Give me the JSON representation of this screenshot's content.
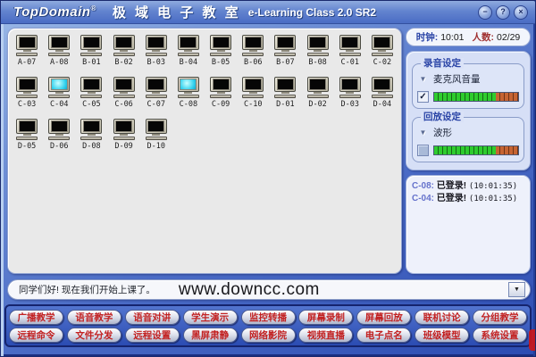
{
  "title_bar": {
    "brand": "TopDomain",
    "reg": "®",
    "title_cn": "极 域 电 子 教 室",
    "title_en": "e-Learning Class 2.0 SR2",
    "minimize": "−",
    "help": "?",
    "close": "×"
  },
  "status": {
    "clock_label": "时钟:",
    "clock_value": "10:01",
    "people_label": "人数:",
    "people_value": "02/29"
  },
  "computers": [
    {
      "label": "A-07",
      "on": false
    },
    {
      "label": "A-08",
      "on": false
    },
    {
      "label": "B-01",
      "on": false
    },
    {
      "label": "B-02",
      "on": false
    },
    {
      "label": "B-03",
      "on": false
    },
    {
      "label": "B-04",
      "on": false
    },
    {
      "label": "B-05",
      "on": false
    },
    {
      "label": "B-06",
      "on": false
    },
    {
      "label": "B-07",
      "on": false
    },
    {
      "label": "B-08",
      "on": false
    },
    {
      "label": "C-01",
      "on": false
    },
    {
      "label": "C-02",
      "on": false
    },
    {
      "label": "C-03",
      "on": false
    },
    {
      "label": "C-04",
      "on": true
    },
    {
      "label": "C-05",
      "on": false
    },
    {
      "label": "C-06",
      "on": false
    },
    {
      "label": "C-07",
      "on": false
    },
    {
      "label": "C-08",
      "on": true
    },
    {
      "label": "C-09",
      "on": false
    },
    {
      "label": "C-10",
      "on": false
    },
    {
      "label": "D-01",
      "on": false
    },
    {
      "label": "D-02",
      "on": false
    },
    {
      "label": "D-03",
      "on": false
    },
    {
      "label": "D-04",
      "on": false
    },
    {
      "label": "D-05",
      "on": false
    },
    {
      "label": "D-06",
      "on": false
    },
    {
      "label": "D-08",
      "on": false
    },
    {
      "label": "D-09",
      "on": false
    },
    {
      "label": "D-10",
      "on": false
    }
  ],
  "record_settings": {
    "group_label": "录音设定",
    "dropdown_icon": "▼",
    "option_label": "麦克风音量",
    "checked": true,
    "level_green": 73
  },
  "playback_settings": {
    "group_label": "回放设定",
    "dropdown_icon": "▼",
    "option_label": "波形",
    "checked": false,
    "level_green": 73
  },
  "log": {
    "entries": [
      {
        "id": "C-08:",
        "text": "已登录!",
        "time": "(10:01:35)"
      },
      {
        "id": "C-04:",
        "text": "已登录!",
        "time": "(10:01:35)"
      }
    ]
  },
  "message_bar": {
    "text": "同学们好! 现在我们开始上课了。",
    "watermark": "www.downcc.com",
    "dropdown_icon": "▼"
  },
  "toolbar": {
    "row1": [
      "广播教学",
      "语音教学",
      "语音对讲",
      "学生演示",
      "监控转播",
      "屏幕录制",
      "屏幕回放",
      "联机讨论",
      "分组教学"
    ],
    "row2": [
      "远程命令",
      "文件分发",
      "远程设置",
      "黑屏肃静",
      "网络影院",
      "视频直播",
      "电子点名",
      "班级模型",
      "系统设置"
    ]
  },
  "colors": {
    "accent_blue": "#3a5bbe",
    "button_text_red": "#c22121",
    "bar_green": "#2ecc2e",
    "bar_orange": "#c66433",
    "screen_on_cyan": "#35d2ee"
  }
}
